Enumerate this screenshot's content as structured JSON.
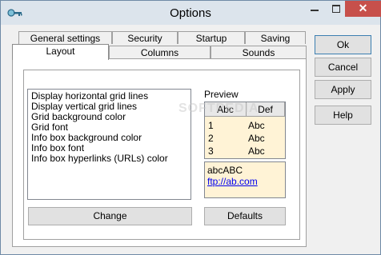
{
  "window": {
    "title": "Options",
    "close_glyph": "✕"
  },
  "tabs_row1": [
    "General settings",
    "Security",
    "Startup",
    "Saving"
  ],
  "tabs_row2": [
    "Layout",
    "Columns",
    "Sounds"
  ],
  "list_items": [
    "Display horizontal grid lines",
    "Display vertical grid lines",
    "Grid background color",
    "Grid font",
    "Info box background color",
    "Info box font",
    "Info box hyperlinks (URLs) color"
  ],
  "preview": {
    "label": "Preview",
    "headers": [
      "Abc",
      "Def"
    ],
    "rows": [
      [
        "1",
        "Abc"
      ],
      [
        "2",
        "Abc"
      ],
      [
        "3",
        "Abc"
      ]
    ],
    "info_text": "abcABC",
    "info_link": "ftp://ab.com"
  },
  "buttons": {
    "change": "Change",
    "defaults": "Defaults",
    "ok": "Ok",
    "cancel": "Cancel",
    "apply": "Apply",
    "help": "Help"
  },
  "watermark": "SOFTPEDIA",
  "colors": {
    "preview_bg": "#fff3d6",
    "close_button": "#c7504b"
  }
}
